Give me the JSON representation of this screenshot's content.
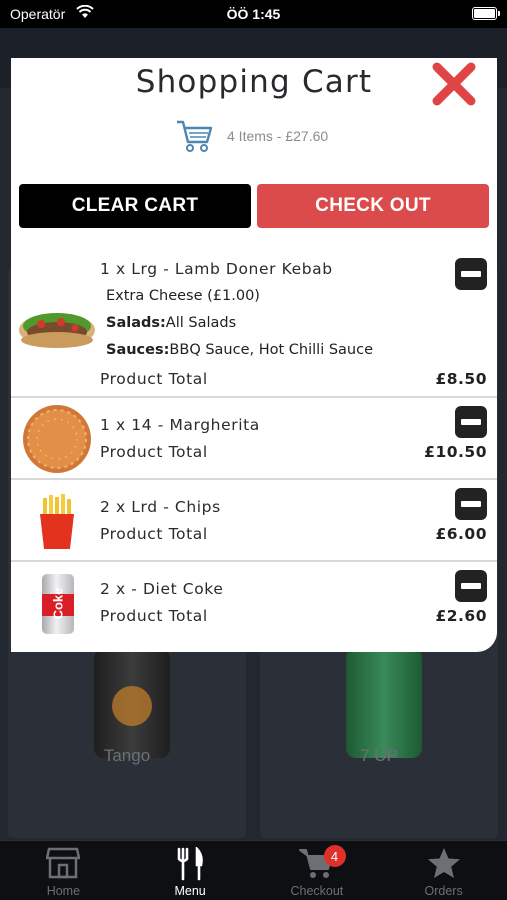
{
  "status_bar": {
    "carrier": "Operatör",
    "time": "ÖÖ 1:45"
  },
  "background": {
    "products": [
      {
        "name": "Tango"
      },
      {
        "name": "7 UP"
      }
    ]
  },
  "cart": {
    "title": "Shopping Cart",
    "summary": "4 Items - £27.60",
    "clear_label": "CLEAR CART",
    "checkout_label": "CHECK OUT",
    "accent_color": "#dc4b4b",
    "items": [
      {
        "name": "1 x Lrg - Lamb Doner Kebab",
        "extra": "Extra Cheese (£1.00)",
        "salads_label": "Salads:",
        "salads": "All Salads",
        "sauces_label": "Sauces:",
        "sauces": "BBQ Sauce, Hot Chilli Sauce",
        "total_label": "Product Total",
        "price": "£8.50",
        "image": "kebab-image"
      },
      {
        "name": "1 x 14 - Margherita",
        "total_label": "Product Total",
        "price": "£10.50",
        "image": "pizza-image"
      },
      {
        "name": "2 x Lrd - Chips",
        "total_label": "Product Total",
        "price": "£6.00",
        "image": "chips-image"
      },
      {
        "name": "2 x - Diet Coke",
        "total_label": "Product Total",
        "price": "£2.60",
        "image": "diet-coke-image",
        "can_text": "Coke"
      }
    ]
  },
  "tab_bar": {
    "tabs": [
      {
        "label": "Home",
        "icon": "store-icon"
      },
      {
        "label": "Menu",
        "icon": "cutlery-icon"
      },
      {
        "label": "Checkout",
        "icon": "cart-icon",
        "badge": "4"
      },
      {
        "label": "Orders",
        "icon": "star-icon"
      }
    ],
    "active": "Menu"
  }
}
